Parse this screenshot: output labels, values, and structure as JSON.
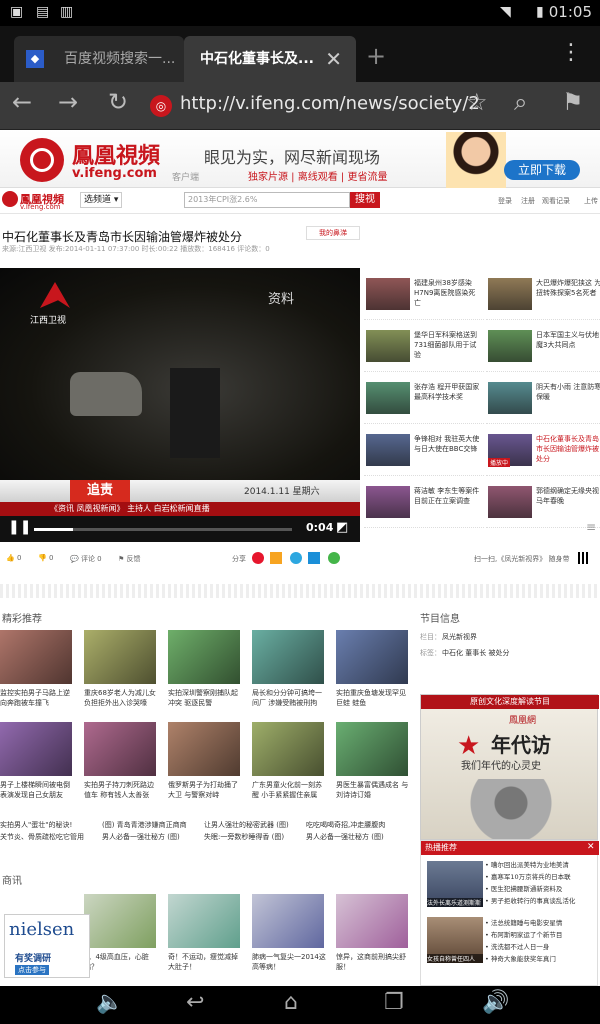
{
  "status": {
    "time": "01:05"
  },
  "tabs": [
    {
      "title": "百度视频搜索一..."
    },
    {
      "title": "中石化董事长及..."
    }
  ],
  "toolbar": {
    "url": "http://v.ifeng.com/news/society/2"
  },
  "banner": {
    "brand": "鳳凰視頻",
    "domain": "v.ifeng.com",
    "client": "客户端",
    "slogan": "眼见为实，网尽新闻现场",
    "subslogan": "独家片源 | 离线观看 | 更省流量",
    "download": "立即下载"
  },
  "site_nav": {
    "logo": "鳳凰視頻",
    "logo_domain": "v.ifeng.com",
    "select_label": "选频道",
    "search_placeholder": "2013年CPI涨2.6%",
    "search_button": "搜视",
    "links": [
      "登录",
      "注册",
      "观看记录",
      "上传"
    ]
  },
  "video": {
    "title": "中石化董事长及青岛市长因输油管爆炸被处分",
    "meta": "来源:江西卫视  发布:2014-01-11 07:37:00  时长:00:22  播放数：168416  评论数：0",
    "report": "我的鼻涕",
    "channel_logo": "江西卫视",
    "watermark": "资料",
    "date_overlay": "2014.1.11 星期六",
    "lower_third": "追责",
    "ticker": "《资讯   凤凰视新闻》   主持人   白岩松新闻直播",
    "time": "0:04",
    "progress": 0.15
  },
  "actions": {
    "like": "0",
    "dislike": "0",
    "comments": "评论 0",
    "feedback": "反馈",
    "share": "分享",
    "qr_text": "扫一扫,《凤光新视界》 随身带"
  },
  "related": [
    {
      "title": "福建泉州38岁感染H7N9离医院感染死亡",
      "tag": ""
    },
    {
      "title": "大巴爆炸爆犯挟这 为扭转殊探案5名死者",
      "tag": ""
    },
    {
      "title": "堡华日军科案格送到731细菌部队用于试验",
      "tag": ""
    },
    {
      "title": "日本军国主义与伏地魔3大共同点",
      "tag": ""
    },
    {
      "title": "张存浩 程开甲获国家最高科学技术奖",
      "tag": ""
    },
    {
      "title": "阴天有小雨 注意防寒保暖",
      "tag": ""
    },
    {
      "title": "争锋相对 我驻英大使与日大使在BBC交锋",
      "tag": ""
    },
    {
      "title": "中石化董事长及青岛市长因输油管爆炸被处分",
      "tag": "播放中"
    },
    {
      "title": "蒋洁敏 李东生等案件目前正在立案调查",
      "tag": ""
    },
    {
      "title": "郭德纲确定无缘央视马年春晚",
      "tag": ""
    }
  ],
  "featured": {
    "heading": "精彩推荐",
    "items": [
      {
        "caption": "监控实拍男子马路上逆向奔跑被车撞飞"
      },
      {
        "caption": "重庆68岁老人为减儿女负担拒外出入诊哭嚎"
      },
      {
        "caption": "实拍深圳警察刚捕队起冲突 驱逐民警"
      },
      {
        "caption": "局长和分分钟可搞垮一间厂 涉嫌受贿被刑拘"
      },
      {
        "caption": "实拍重庆鱼塘发现罕见巨蛙 蛙鱼"
      },
      {
        "caption": "男子上楼梯瞬间被电倒 表演发现自己女朋友"
      },
      {
        "caption": "实拍男子持刀刺死路边值车 称有钱人太善张"
      },
      {
        "caption": "俄罗斯男子为打劫捅了大卫 与警察对峙"
      },
      {
        "caption": "广东男童火化前一刻苏醒 小手紧紧握住亲属"
      },
      {
        "caption": "男医生暴富偶遇成名 与刘诗诗订婚"
      }
    ],
    "links": [
      [
        "实拍男人\"蛋壮\"的秘诀!",
        "(图) 青岛青港涉嫌商正商商",
        "让男人强壮的秘密武器 (图)",
        "吃吃喝喝奇招,冲走腰腹肉"
      ],
      [
        "关节炎、骨质疏松吃它管用",
        "男人必备一强壮秘方 (图)",
        "失眠:一旁数秒睡得香 (图)",
        "男人必备一强壮秘方 (图)"
      ]
    ]
  },
  "program_info": {
    "heading": "节目信息",
    "show_label": "栏目：",
    "show_value": "凤光新视界",
    "tags_label": "标签：",
    "tags_value": "中石化  董事长  被处分"
  },
  "ad_right": {
    "top": "原创文化深度解读节目",
    "brand": "鳳凰網",
    "title": "年代访",
    "subtitle": "我们年代的心灵史"
  },
  "hot": {
    "heading": "热播推荐",
    "items": [
      "• 嘈尔回出派美特为业地美清",
      "• 嘉寒军10万京将兵的日本联",
      "• 医生犯拂腰斯通新资料及",
      "• 男子拒收转行的事真谈乱活化"
    ],
    "items2": [
      "• 法总统籍睡与电影安星情",
      "• 布阿斯明家运了个新节目",
      "• 洗洗都不过人日一身",
      "• 神奇大象能获奖年真门"
    ],
    "thumb1": "法外长离乐道测斯斯",
    "thumb2": "女孩自称曾任四人"
  },
  "business": {
    "heading": "商讯",
    "items": [
      {
        "caption": "有奖调研"
      },
      {
        "caption": "3、4级高血压，心脏病？"
      },
      {
        "caption": "奇！不运动，瘦觉减掉大肚子！"
      },
      {
        "caption": "肺病一气复尖一2014这高等病！"
      },
      {
        "caption": "惊异，这商前刑搞尖舒服！"
      }
    ],
    "ad_brand": "nielsen",
    "ad_sub": "点击参与"
  },
  "colors": {
    "ifeng_red": "#c8161d",
    "tab_dark": "#121212",
    "toolbar": "#3a3a3a"
  }
}
